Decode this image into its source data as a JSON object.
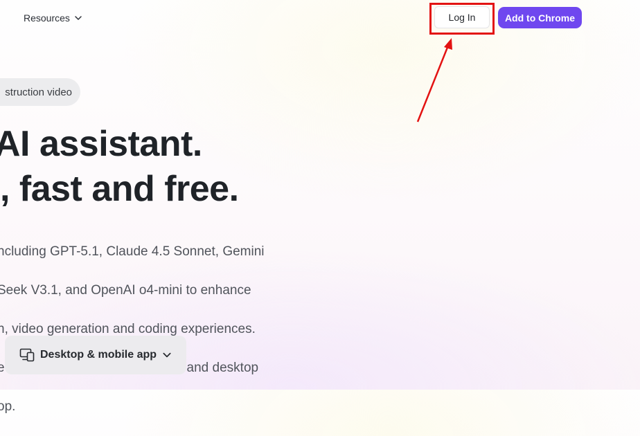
{
  "nav": {
    "resources_label": "Resources",
    "login_label": "Log In",
    "add_to_chrome_label": "Add to Chrome"
  },
  "hero": {
    "pill_label": "struction video",
    "headline_line1": "AI assistant.",
    "headline_line2": ", fast and free.",
    "description_lines": [
      "ncluding GPT-5.1, Claude 4.5 Sonnet, Gemini",
      "Seek V3.1, and OpenAI o4-mini to enhance",
      "n, video generation and coding experiences.",
      "e and Edge, as well as a mobile and desktop",
      "op."
    ],
    "app_button_label": "Desktop & mobile app"
  },
  "colors": {
    "accent": "#6f47ef",
    "highlight": "#e31212"
  },
  "icons": {
    "resources_chevron": "chevron-down-icon",
    "app_button_icon": "devices-icon",
    "app_button_chevron": "chevron-down-icon"
  }
}
